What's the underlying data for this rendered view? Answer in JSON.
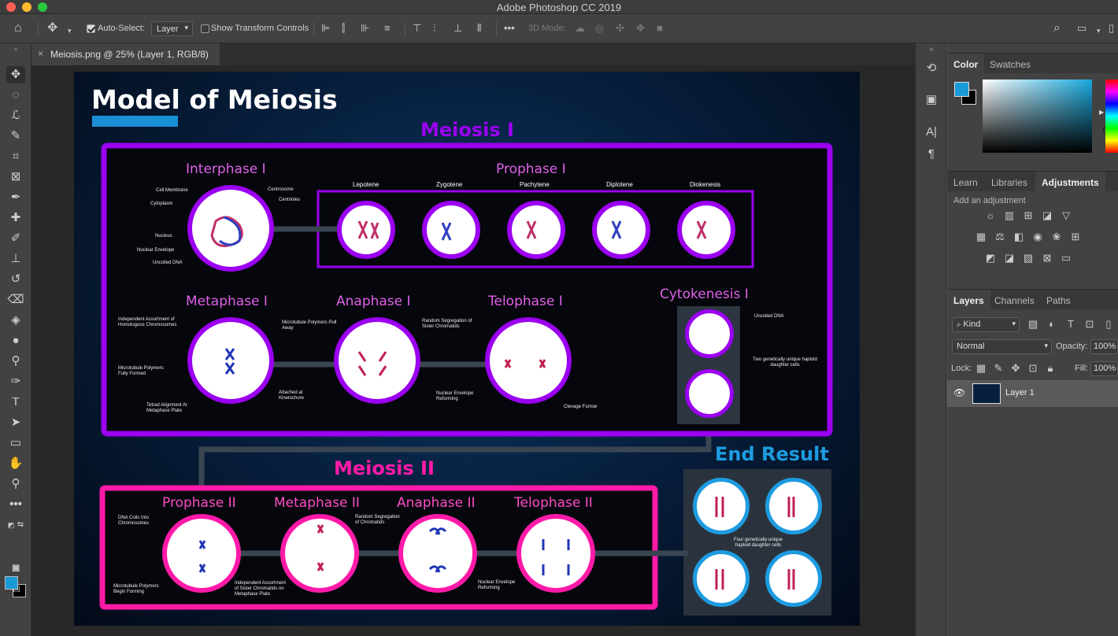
{
  "app": {
    "title": "Adobe Photoshop CC 2019"
  },
  "options_bar": {
    "auto_select_label": "Auto-Select:",
    "auto_select_value": "Layer",
    "show_transform_label": "Show Transform Controls",
    "mode_3d_label": "3D Mode:",
    "more_label": "•••"
  },
  "document_tab": {
    "title": "Meiosis.png @ 25% (Layer 1, RGB/8)",
    "close": "×"
  },
  "artwork": {
    "title": "Model of Meiosis",
    "meiosis1": "Meiosis I",
    "meiosis2": "Meiosis II",
    "end_result": "End Result",
    "phases": {
      "interphase": "Interphase I",
      "prophase1": "Prophase I",
      "metaphase1": "Metaphase I",
      "anaphase1": "Anaphase I",
      "telophase1": "Telophase I",
      "cytokinesis1": "Cytokenesis I",
      "prophase2": "Prophase II",
      "metaphase2": "Metaphase II",
      "anaphase2": "Anaphase II",
      "telophase2": "Telophase II"
    },
    "prophase_substages": [
      "Lepotene",
      "Zygotene",
      "Pachytene",
      "Diplotene",
      "Diokenesis"
    ],
    "notes": {
      "cell_membrane": "Cell Membrane",
      "centrosome": "Centrosome",
      "centrioles": "Centrioles",
      "cytoplasm": "Cytoplasm",
      "nucleus": "Nucleus",
      "nuclear_envelope": "Nuclear Envelope",
      "uncoiled_dna": "Uncoiled DNA",
      "independent_assortment": "Independent Assortment of Homologous Chromosomes",
      "microtubule_fully": "Microtubule Polymers Fully Formed",
      "tetrad": "Tetrad Alignment At Metaphase Plate",
      "attached": "Attached at Kinetochore",
      "microtubule_pull": "Microtubule Polymers Pull Away",
      "random_seg": "Random Segregation of Sister Chromatids",
      "nuclear_reforming": "Nuclear Envelope Reforming",
      "cleavage": "Clevage Furrow",
      "uncoiled_dna2": "Uncoiled DNA",
      "two_daughter": "Two genetically unique haploid daughter cells",
      "dna_coils": "DNA Coils Into Chromosomes",
      "microtubule_begin": "Microtubule Polymers Begin Forming",
      "independent_sister": "Independent Assortment of Sister Chromatids on Metaphase Plate",
      "random_seg2": "Random Segregation of Chromatids",
      "nuclear_reforming2": "Nuclear Envelope Reforming",
      "four_daughter": "Four genetically unique haploid daughter cells"
    }
  },
  "panels": {
    "color_tabs": [
      "Color",
      "Swatches"
    ],
    "mid_tabs": [
      "Learn",
      "Libraries",
      "Adjustments"
    ],
    "add_adjustment": "Add an adjustment",
    "layer_tabs": [
      "Layers",
      "Channels",
      "Paths"
    ],
    "kind_label": "Kind",
    "blend_mode": "Normal",
    "opacity_label": "Opacity:",
    "opacity_value": "100%",
    "lock_label": "Lock:",
    "fill_label": "Fill:",
    "fill_value": "100%",
    "layer_name": "Layer 1"
  },
  "colors": {
    "foreground": "#1a9bd7",
    "background": "#000000",
    "meiosis1_purple": "#9b00f0",
    "meiosis2_pink": "#ff1aa8",
    "end_blue": "#1e9be0"
  }
}
